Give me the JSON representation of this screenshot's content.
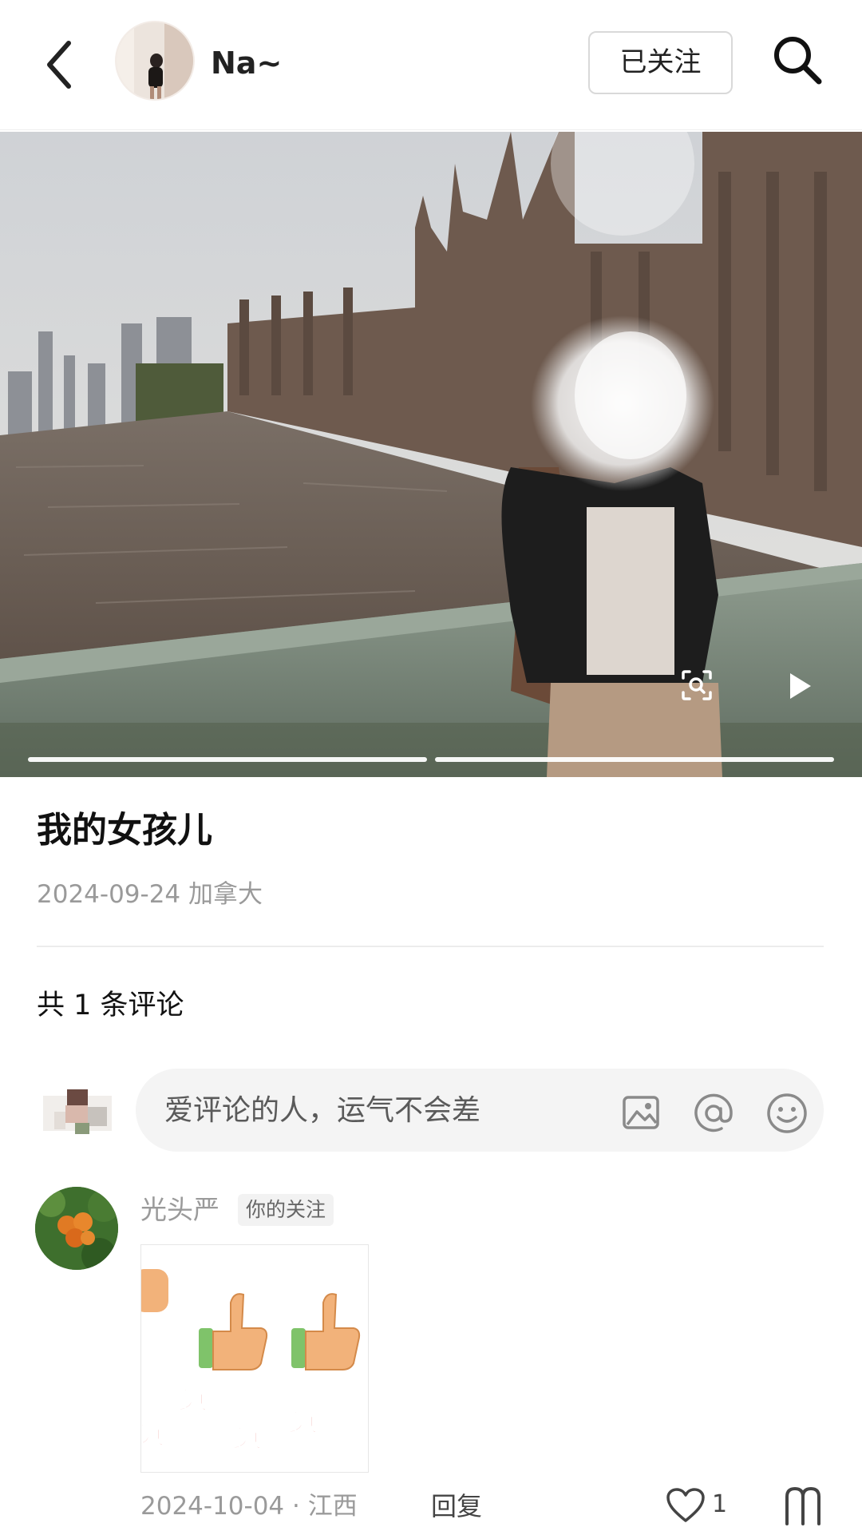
{
  "header": {
    "username": "Na~",
    "follow_label": "已关注",
    "icons": [
      "back-icon",
      "search-icon"
    ]
  },
  "photo": {
    "slides_total": 2,
    "current_slide": 1,
    "icons": [
      "image-search-icon",
      "play-icon"
    ]
  },
  "post": {
    "title": "我的女孩儿",
    "date_location": "2024-09-24 加拿大"
  },
  "comments_section": {
    "count_label": "共 1 条评论",
    "input_placeholder": "爱评论的人，运气不会差",
    "input_icons": [
      "image-icon",
      "at-icon",
      "emoji-icon"
    ]
  },
  "comment": {
    "user": "光头严",
    "badge": "你的关注",
    "sticker_text": [
      "赞",
      "赞",
      "赞",
      "赞"
    ],
    "date_location": "2024-10-04 · 江西",
    "reply_label": "回复",
    "like_count": "1",
    "icons": [
      "heart-icon",
      "more-icon"
    ]
  },
  "colors": {
    "background": "#ffffff",
    "secondary_text": "#9a9a9a",
    "input_bg": "#f4f4f4",
    "sticker_red": "#d9261c"
  }
}
